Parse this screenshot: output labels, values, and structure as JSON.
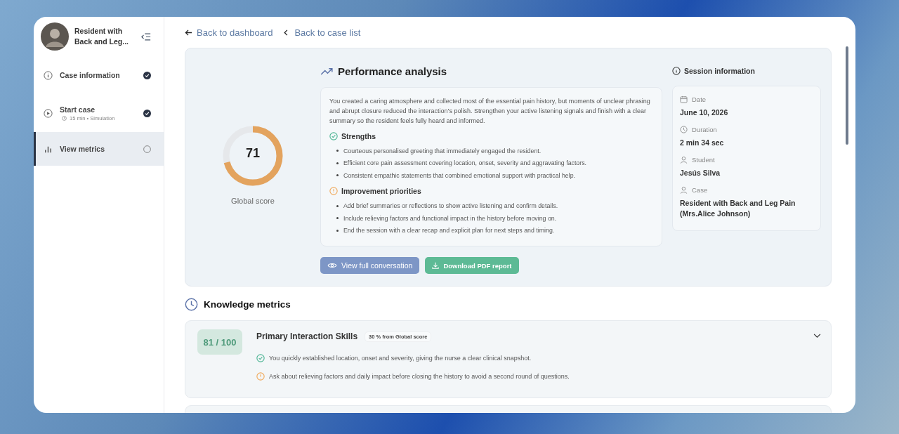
{
  "sidebar": {
    "case_title": "Resident with Back and Leg...",
    "items": [
      {
        "kind": "info",
        "label": "Case information",
        "completed": true,
        "selected": false
      },
      {
        "kind": "play",
        "label": "Start case",
        "meta": "15 min • Simulation",
        "completed": true,
        "selected": false
      },
      {
        "kind": "chart",
        "label": "View metrics",
        "completed": false,
        "selected": true
      }
    ]
  },
  "nav": {
    "back_dashboard": "Back to dashboard",
    "back_case_list": "Back to case list"
  },
  "score": {
    "value": "71",
    "level": 0.71,
    "label": "Global score"
  },
  "performance": {
    "title": "Performance analysis",
    "summary": "You created a caring atmosphere and collected most of the essential pain history, but moments of unclear phrasing and abrupt closure reduced the interaction’s polish. Strengthen your active listening signals and finish with a clear summary so the resident feels fully heard and informed.",
    "sections": [
      {
        "kind": "success",
        "title": "Strengths",
        "items": [
          "Courteous personalised greeting that immediately engaged the resident.",
          "Efficient core pain assessment covering location, onset, severity and aggravating factors.",
          "Consistent empathic statements that combined emotional support with practical help."
        ]
      },
      {
        "kind": "warning",
        "title": "Improvement priorities",
        "items": [
          "Add brief summaries or reflections to show active listening and confirm details.",
          "Include relieving factors and functional impact in the history before moving on.",
          "End the session with a clear recap and explicit plan for next steps and timing."
        ]
      }
    ],
    "buttons": [
      {
        "kind": "view",
        "label": "View full conversation"
      },
      {
        "kind": "download",
        "label": "Download PDF report"
      }
    ]
  },
  "session": {
    "title": "Session information",
    "fields": [
      {
        "kind": "date",
        "label": "Date",
        "value": "June 10, 2026"
      },
      {
        "kind": "clock",
        "label": "Duration",
        "value": "2 min 34 sec"
      },
      {
        "kind": "person",
        "label": "Student",
        "value": "Jesús Silva"
      },
      {
        "kind": "person",
        "label": "Case",
        "value": "Resident with Back and Leg Pain (Mrs.Alice Johnson)"
      }
    ]
  },
  "knowledge": {
    "title": "Knowledge metrics",
    "metrics": [
      {
        "score": "81 / 100",
        "title": "Primary Interaction Skills",
        "weight": "30 % from Global score",
        "expanded": false,
        "notes": [
          {
            "kind": "success",
            "text": "You quickly established location, onset and severity, giving the nurse a clear clinical snapshot."
          },
          {
            "kind": "warning",
            "text": "Ask about relieving factors and daily impact before closing the history to avoid a second round of questions."
          }
        ]
      }
    ]
  }
}
